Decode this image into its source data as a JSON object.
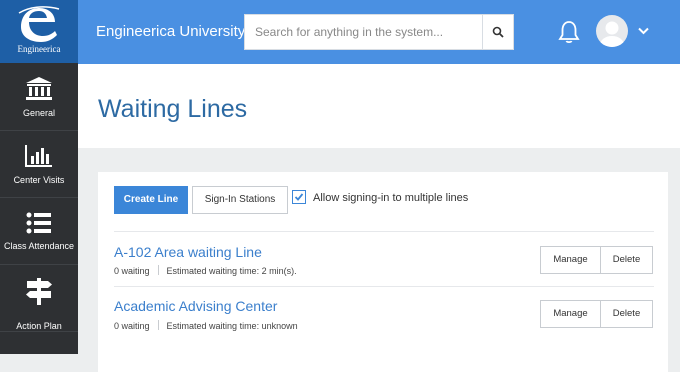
{
  "logo": {
    "text": "Engineerica"
  },
  "nav": [
    {
      "label": "General",
      "icon": "bank-icon"
    },
    {
      "label": "Center Visits",
      "icon": "bar-chart-icon"
    },
    {
      "label": "Class Attendance",
      "icon": "list-icon"
    },
    {
      "label": "Action Plan",
      "icon": "signpost-icon"
    }
  ],
  "header": {
    "brand": "Engineerica University",
    "search_placeholder": "Search for anything in the system...",
    "accent": "#4a90e2"
  },
  "page": {
    "title": "Waiting Lines"
  },
  "toolbar": {
    "create_label": "Create Line",
    "stations_label": "Sign-In Stations",
    "multi_line_label": "Allow signing-in to multiple lines",
    "multi_line_checked": true
  },
  "lines": [
    {
      "name": "A-102 Area waiting Line",
      "waiting": "0 waiting",
      "estimate": "Estimated waiting time: 2 min(s).",
      "manage": "Manage",
      "delete": "Delete"
    },
    {
      "name": "Academic Advising Center",
      "waiting": "0 waiting",
      "estimate": "Estimated waiting time: unknown",
      "manage": "Manage",
      "delete": "Delete"
    }
  ]
}
